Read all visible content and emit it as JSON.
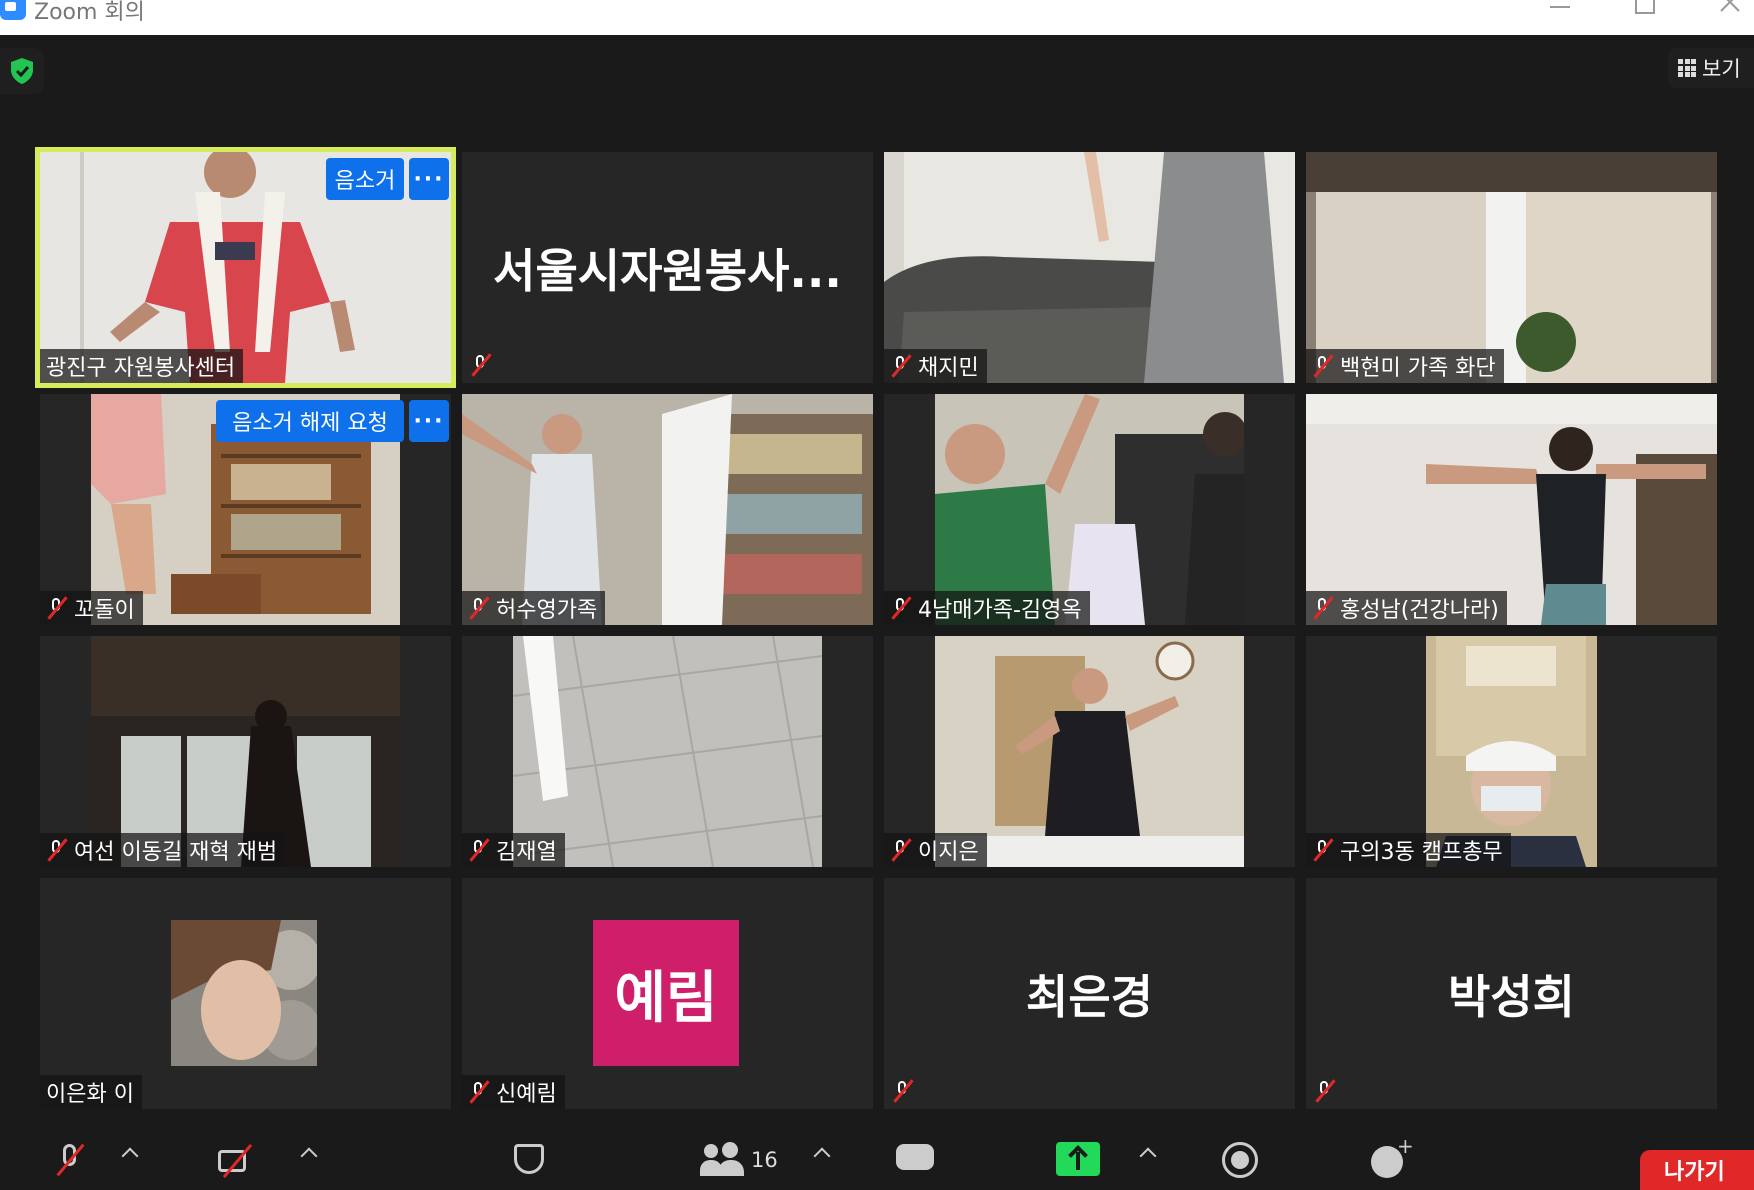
{
  "window": {
    "title": "Zoom 회의"
  },
  "header": {
    "view_label": "보기"
  },
  "tiles": [
    {
      "name": "광진구 자원봉사센터",
      "active": true,
      "muted": false,
      "mute_button": "음소거"
    },
    {
      "display_name": "서울시자원봉사...",
      "muted": true
    },
    {
      "name": "채지민",
      "muted": true
    },
    {
      "name": "백현미 가족 화단",
      "muted": true
    },
    {
      "name": "꼬돌이",
      "muted": true,
      "unmute_request_button": "음소거 해제 요청"
    },
    {
      "name": "허수영가족",
      "muted": true
    },
    {
      "name": "4남매가족-김영옥",
      "muted": true
    },
    {
      "name": "홍성남(건강나라)",
      "muted": true
    },
    {
      "name": "여선 이동길 재혁 재범",
      "muted": true
    },
    {
      "name": "김재열",
      "muted": true
    },
    {
      "name": "이지은",
      "muted": true
    },
    {
      "name": "구의3동 캠프총무",
      "muted": true
    },
    {
      "name": "이은화 이",
      "muted": false
    },
    {
      "name": "신예림",
      "avatar_initials": "예림",
      "muted": true
    },
    {
      "display_name": "최은경",
      "muted": true
    },
    {
      "display_name": "박성희",
      "muted": true
    }
  ],
  "toolbar": {
    "participant_count": "16",
    "leave_label": "나가기"
  },
  "colors": {
    "active_speaker": "#d7ec5d",
    "button_blue": "#0e71eb",
    "share_green": "#23d959",
    "leave_red": "#e02828",
    "avatar_pink": "#d01f6a"
  }
}
